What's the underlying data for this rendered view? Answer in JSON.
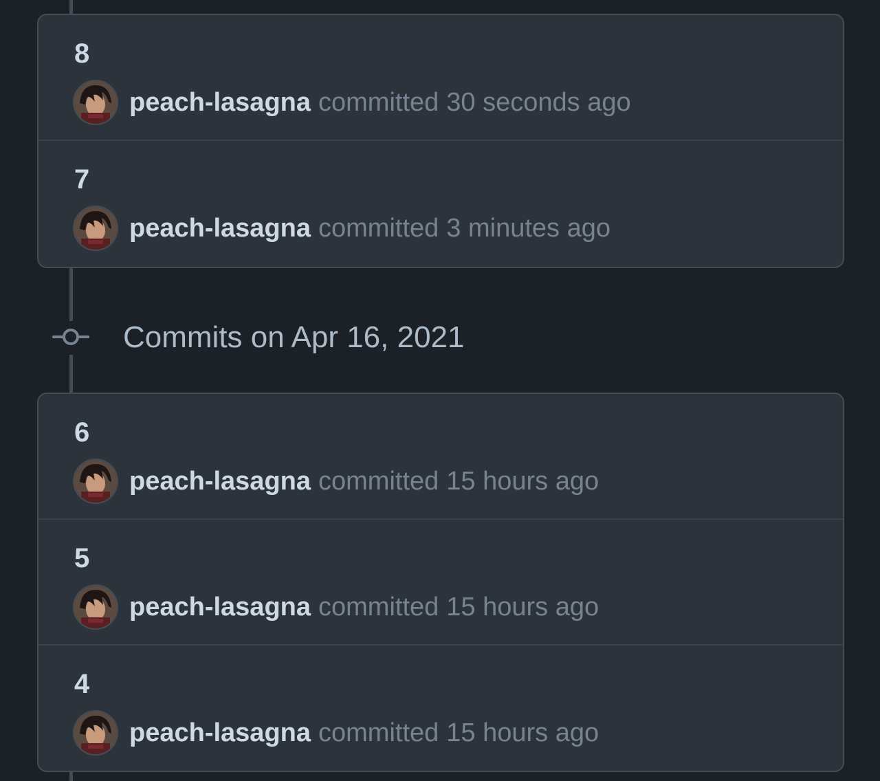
{
  "groups": [
    {
      "commits": [
        {
          "title": "8",
          "author": "peach-lasagna",
          "verb": "committed",
          "when": "30 seconds ago"
        },
        {
          "title": "7",
          "author": "peach-lasagna",
          "verb": "committed",
          "when": "3 minutes ago"
        }
      ]
    },
    {
      "header": "Commits on Apr 16, 2021",
      "commits": [
        {
          "title": "6",
          "author": "peach-lasagna",
          "verb": "committed",
          "when": "15 hours ago"
        },
        {
          "title": "5",
          "author": "peach-lasagna",
          "verb": "committed",
          "when": "15 hours ago"
        },
        {
          "title": "4",
          "author": "peach-lasagna",
          "verb": "committed",
          "when": "15 hours ago"
        }
      ]
    }
  ],
  "icons": {
    "commit": "git-commit-icon",
    "avatar": "user-avatar"
  },
  "colors": {
    "background": "#1c2128",
    "card": "#2d333b",
    "border": "#444c56",
    "text_primary": "#cdd9e5",
    "text_muted": "#768390"
  }
}
